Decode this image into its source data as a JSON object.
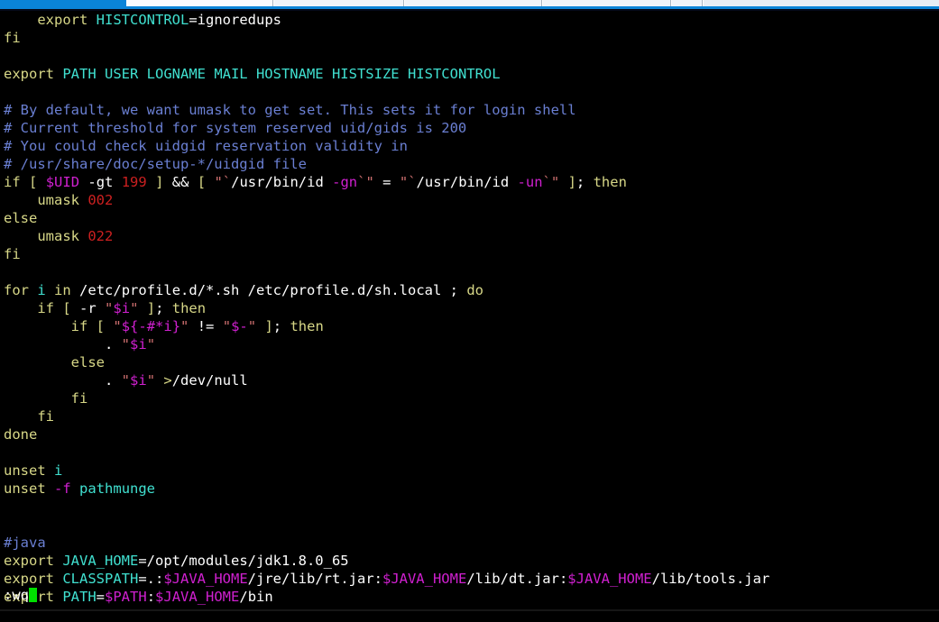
{
  "window": {
    "tabstrip": {
      "accent_color": "#0a84d8",
      "tab_fill": "#eef4fa",
      "tabs": [
        {
          "label": ""
        },
        {
          "label": ""
        },
        {
          "label": ""
        },
        {
          "label": ""
        },
        {
          "label": ""
        }
      ]
    }
  },
  "editor": {
    "app": "vim",
    "background_color": "#000000",
    "cursor_color": "#00e000",
    "command_line": ":wq",
    "colors": {
      "keyword": "#d7d787",
      "identifier": "#40e0d0",
      "plain": "#ffffff",
      "comment": "#6a7fd2",
      "number": "#cc2020",
      "variable": "#d020d0",
      "string": "#d07070",
      "option": "#d020d0"
    },
    "lines": [
      [
        {
          "t": "    ",
          "c": "plain"
        },
        {
          "t": "export",
          "c": "keyword"
        },
        {
          "t": " ",
          "c": "plain"
        },
        {
          "t": "HISTCONTROL",
          "c": "identifier"
        },
        {
          "t": "=ignoredups",
          "c": "plain"
        }
      ],
      [
        {
          "t": "fi",
          "c": "keyword"
        }
      ],
      [],
      [
        {
          "t": "export",
          "c": "keyword"
        },
        {
          "t": " ",
          "c": "plain"
        },
        {
          "t": "PATH USER LOGNAME MAIL HOSTNAME HISTSIZE HISTCONTROL",
          "c": "identifier"
        }
      ],
      [],
      [
        {
          "t": "# By default, we want umask to get set. This sets it for login shell",
          "c": "comment"
        }
      ],
      [
        {
          "t": "# Current threshold for system reserved uid/gids is 200",
          "c": "comment"
        }
      ],
      [
        {
          "t": "# You could check uidgid reservation validity in",
          "c": "comment"
        }
      ],
      [
        {
          "t": "# /usr/share/doc/setup-*/uidgid file",
          "c": "comment"
        }
      ],
      [
        {
          "t": "if",
          "c": "keyword"
        },
        {
          "t": " ",
          "c": "plain"
        },
        {
          "t": "[",
          "c": "keyword"
        },
        {
          "t": " ",
          "c": "plain"
        },
        {
          "t": "$UID",
          "c": "variable"
        },
        {
          "t": " ",
          "c": "plain"
        },
        {
          "t": "-gt",
          "c": "plain"
        },
        {
          "t": " ",
          "c": "plain"
        },
        {
          "t": "199",
          "c": "number"
        },
        {
          "t": " ",
          "c": "plain"
        },
        {
          "t": "]",
          "c": "keyword"
        },
        {
          "t": " ",
          "c": "plain"
        },
        {
          "t": "&&",
          "c": "plain"
        },
        {
          "t": " ",
          "c": "plain"
        },
        {
          "t": "[",
          "c": "keyword"
        },
        {
          "t": " ",
          "c": "plain"
        },
        {
          "t": "\"",
          "c": "string"
        },
        {
          "t": "`",
          "c": "string"
        },
        {
          "t": "/usr/bin/id",
          "c": "plain"
        },
        {
          "t": " ",
          "c": "plain"
        },
        {
          "t": "-gn",
          "c": "variable"
        },
        {
          "t": "`",
          "c": "string"
        },
        {
          "t": "\"",
          "c": "string"
        },
        {
          "t": " ",
          "c": "plain"
        },
        {
          "t": "=",
          "c": "plain"
        },
        {
          "t": " ",
          "c": "plain"
        },
        {
          "t": "\"",
          "c": "string"
        },
        {
          "t": "`",
          "c": "string"
        },
        {
          "t": "/usr/bin/id",
          "c": "plain"
        },
        {
          "t": " ",
          "c": "plain"
        },
        {
          "t": "-un",
          "c": "variable"
        },
        {
          "t": "`",
          "c": "string"
        },
        {
          "t": "\"",
          "c": "string"
        },
        {
          "t": " ",
          "c": "plain"
        },
        {
          "t": "]",
          "c": "keyword"
        },
        {
          "t": "; ",
          "c": "plain"
        },
        {
          "t": "then",
          "c": "keyword"
        }
      ],
      [
        {
          "t": "    ",
          "c": "plain"
        },
        {
          "t": "umask",
          "c": "keyword"
        },
        {
          "t": " ",
          "c": "plain"
        },
        {
          "t": "002",
          "c": "number"
        }
      ],
      [
        {
          "t": "else",
          "c": "keyword"
        }
      ],
      [
        {
          "t": "    ",
          "c": "plain"
        },
        {
          "t": "umask",
          "c": "keyword"
        },
        {
          "t": " ",
          "c": "plain"
        },
        {
          "t": "022",
          "c": "number"
        }
      ],
      [
        {
          "t": "fi",
          "c": "keyword"
        }
      ],
      [],
      [
        {
          "t": "for",
          "c": "keyword"
        },
        {
          "t": " ",
          "c": "plain"
        },
        {
          "t": "i",
          "c": "identifier"
        },
        {
          "t": " ",
          "c": "plain"
        },
        {
          "t": "in",
          "c": "keyword"
        },
        {
          "t": " ",
          "c": "plain"
        },
        {
          "t": "/etc/profile.d/*.sh /etc/profile.d/sh.local ",
          "c": "plain"
        },
        {
          "t": ";",
          "c": "plain"
        },
        {
          "t": " ",
          "c": "plain"
        },
        {
          "t": "do",
          "c": "keyword"
        }
      ],
      [
        {
          "t": "    ",
          "c": "plain"
        },
        {
          "t": "if",
          "c": "keyword"
        },
        {
          "t": " ",
          "c": "plain"
        },
        {
          "t": "[",
          "c": "keyword"
        },
        {
          "t": " ",
          "c": "plain"
        },
        {
          "t": "-r",
          "c": "plain"
        },
        {
          "t": " ",
          "c": "plain"
        },
        {
          "t": "\"",
          "c": "string"
        },
        {
          "t": "$i",
          "c": "variable"
        },
        {
          "t": "\"",
          "c": "string"
        },
        {
          "t": " ",
          "c": "plain"
        },
        {
          "t": "]",
          "c": "keyword"
        },
        {
          "t": "; ",
          "c": "plain"
        },
        {
          "t": "then",
          "c": "keyword"
        }
      ],
      [
        {
          "t": "        ",
          "c": "plain"
        },
        {
          "t": "if",
          "c": "keyword"
        },
        {
          "t": " ",
          "c": "plain"
        },
        {
          "t": "[",
          "c": "keyword"
        },
        {
          "t": " ",
          "c": "plain"
        },
        {
          "t": "\"",
          "c": "string"
        },
        {
          "t": "${-#*i}",
          "c": "variable"
        },
        {
          "t": "\"",
          "c": "string"
        },
        {
          "t": " ",
          "c": "plain"
        },
        {
          "t": "!=",
          "c": "plain"
        },
        {
          "t": " ",
          "c": "plain"
        },
        {
          "t": "\"",
          "c": "string"
        },
        {
          "t": "$-",
          "c": "variable"
        },
        {
          "t": "\"",
          "c": "string"
        },
        {
          "t": " ",
          "c": "plain"
        },
        {
          "t": "]",
          "c": "keyword"
        },
        {
          "t": "; ",
          "c": "plain"
        },
        {
          "t": "then",
          "c": "keyword"
        }
      ],
      [
        {
          "t": "            ",
          "c": "plain"
        },
        {
          "t": ".",
          "c": "plain"
        },
        {
          "t": " ",
          "c": "plain"
        },
        {
          "t": "\"",
          "c": "string"
        },
        {
          "t": "$i",
          "c": "variable"
        },
        {
          "t": "\"",
          "c": "string"
        }
      ],
      [
        {
          "t": "        ",
          "c": "plain"
        },
        {
          "t": "else",
          "c": "keyword"
        }
      ],
      [
        {
          "t": "            ",
          "c": "plain"
        },
        {
          "t": ".",
          "c": "plain"
        },
        {
          "t": " ",
          "c": "plain"
        },
        {
          "t": "\"",
          "c": "string"
        },
        {
          "t": "$i",
          "c": "variable"
        },
        {
          "t": "\"",
          "c": "string"
        },
        {
          "t": " ",
          "c": "plain"
        },
        {
          "t": ">",
          "c": "keyword"
        },
        {
          "t": "/dev/null",
          "c": "plain"
        }
      ],
      [
        {
          "t": "        ",
          "c": "plain"
        },
        {
          "t": "fi",
          "c": "keyword"
        }
      ],
      [
        {
          "t": "    ",
          "c": "plain"
        },
        {
          "t": "fi",
          "c": "keyword"
        }
      ],
      [
        {
          "t": "done",
          "c": "keyword"
        }
      ],
      [],
      [
        {
          "t": "unset",
          "c": "keyword"
        },
        {
          "t": " ",
          "c": "plain"
        },
        {
          "t": "i",
          "c": "identifier"
        }
      ],
      [
        {
          "t": "unset",
          "c": "keyword"
        },
        {
          "t": " ",
          "c": "plain"
        },
        {
          "t": "-f",
          "c": "option"
        },
        {
          "t": " ",
          "c": "plain"
        },
        {
          "t": "pathmunge",
          "c": "identifier"
        }
      ],
      [],
      [],
      [
        {
          "t": "#java",
          "c": "comment"
        }
      ],
      [
        {
          "t": "export",
          "c": "keyword"
        },
        {
          "t": " ",
          "c": "plain"
        },
        {
          "t": "JAVA_HOME",
          "c": "identifier"
        },
        {
          "t": "=/opt/modules/jdk1.8.0_65",
          "c": "plain"
        }
      ],
      [
        {
          "t": "export",
          "c": "keyword"
        },
        {
          "t": " ",
          "c": "plain"
        },
        {
          "t": "CLASSPATH",
          "c": "identifier"
        },
        {
          "t": "=.:",
          "c": "plain"
        },
        {
          "t": "$JAVA_HOME",
          "c": "variable"
        },
        {
          "t": "/jre/lib/rt.jar:",
          "c": "plain"
        },
        {
          "t": "$JAVA_HOME",
          "c": "variable"
        },
        {
          "t": "/lib/dt.jar:",
          "c": "plain"
        },
        {
          "t": "$JAVA_HOME",
          "c": "variable"
        },
        {
          "t": "/lib/tools.jar",
          "c": "plain"
        }
      ],
      [
        {
          "t": "export",
          "c": "keyword"
        },
        {
          "t": " ",
          "c": "plain"
        },
        {
          "t": "PATH",
          "c": "identifier"
        },
        {
          "t": "=",
          "c": "plain"
        },
        {
          "t": "$PATH",
          "c": "variable"
        },
        {
          "t": ":",
          "c": "plain"
        },
        {
          "t": "$JAVA_HOME",
          "c": "variable"
        },
        {
          "t": "/bin",
          "c": "plain"
        }
      ]
    ]
  }
}
